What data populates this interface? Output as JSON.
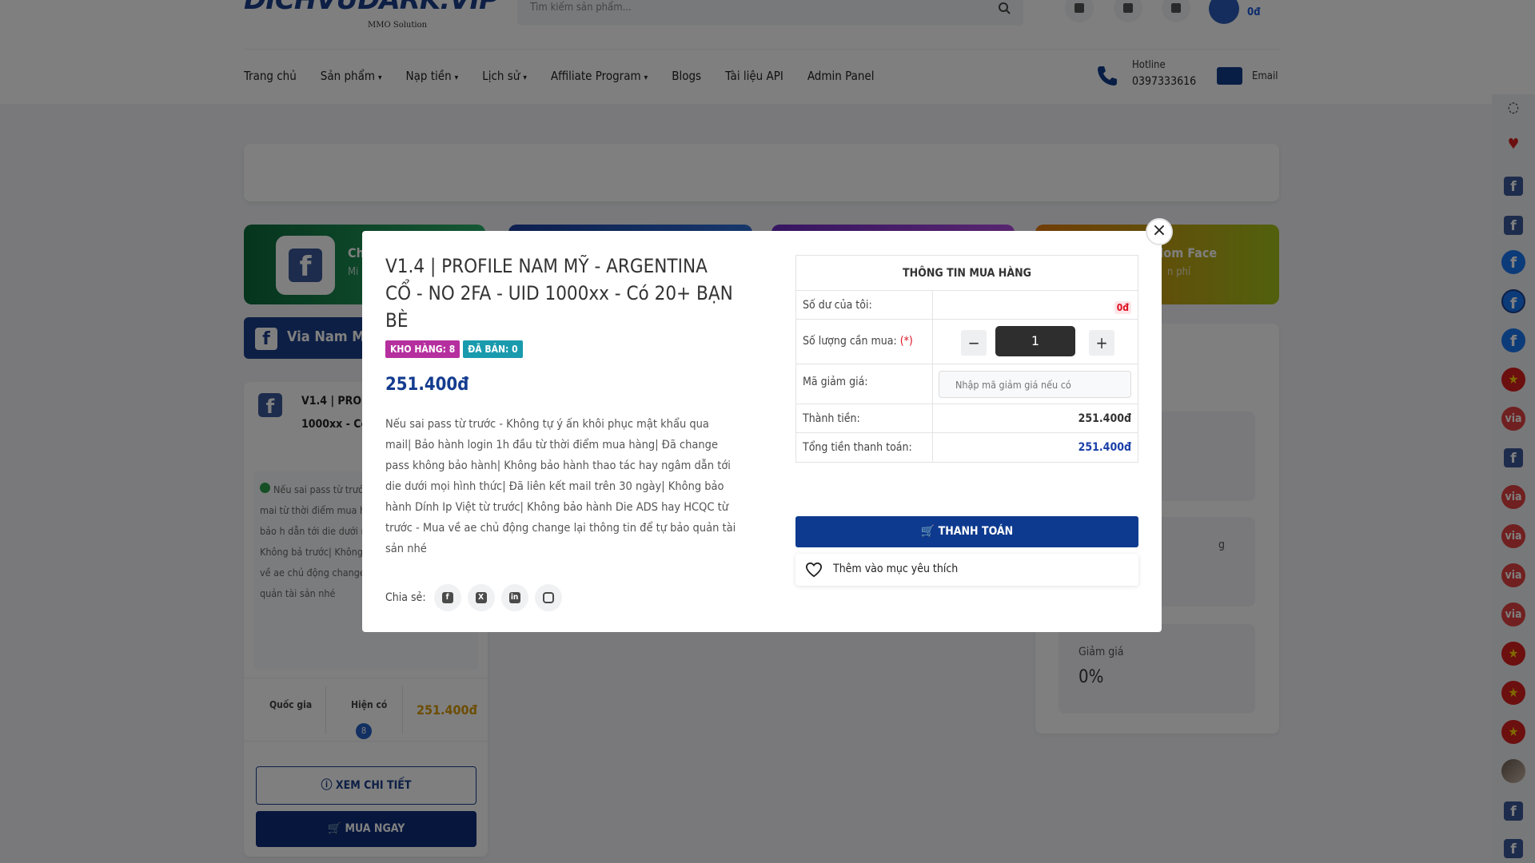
{
  "header": {
    "logo_text": "DICHVUDARK.VIP",
    "logo_sub": "MMO Solution",
    "search_placeholder": "Tìm kiếm sản phẩm...",
    "balance": "0đ"
  },
  "nav": {
    "items": [
      {
        "label": "Trang chủ",
        "caret": false
      },
      {
        "label": "Sản phẩm",
        "caret": true
      },
      {
        "label": "Nạp tiền",
        "caret": true
      },
      {
        "label": "Lịch sử",
        "caret": true
      },
      {
        "label": "Affiliate Program",
        "caret": true
      },
      {
        "label": "Blogs",
        "caret": false
      },
      {
        "label": "Tài liệu API",
        "caret": false
      },
      {
        "label": "Admin Panel",
        "caret": false
      }
    ],
    "hotline_label": "Hotline",
    "hotline_number": "0397333616",
    "email_label": "Email"
  },
  "categories": [
    {
      "title": "Ch",
      "sub": "Mi"
    },
    {
      "title": "dom Face",
      "sub": "n phí"
    }
  ],
  "section_tab": "Via Nam Mỹ",
  "product_card": {
    "title": "V1.4 | PROF ARGENTINA 1000xx - Có",
    "desc": "Nếu sai pass từ trước phục mật khẩu qua mai từ thời điểm mua hàng bảo hành| Không bảo h dẫn tới die dưới mọi hìn trên 30 ngày| Không bả trước| Không bảo hành trước - Mua về ae chủ động change lại thông tin để tự bảo quản tài sản nhé",
    "stat_country": "Quốc gia",
    "stat_stock": "Hiện có",
    "stock": "8",
    "price": "251.400đ",
    "detail_button": "XEM CHI TIẾT",
    "buy_button": "MUA NGAY"
  },
  "right_panel": {
    "label_1": "g",
    "discount_label": "Giảm giá",
    "discount_value": "0%"
  },
  "modal": {
    "title": "V1.4 | PROFILE NAM MỸ - ARGENTINA CỔ - NO 2FA - UID 1000xx - Có 20+ BẠN BÈ",
    "badge_stock": "KHO HÀNG: 8",
    "badge_sold": "ĐÃ BÁN: 0",
    "price": "251.400đ",
    "description": "Nếu sai pass từ trước - Không tự ý ấn khôi phục mật khẩu qua mail| Bảo hành login 1h đầu từ thời điểm mua hàng| Đã change pass không bảo hành| Không bảo hành thao tác hay ngâm dẫn tới die dưới mọi hình thức| Đã liên kết mail trên 30 ngày| Không bảo hành Dính Ip Việt từ trước| Không bảo hành Die ADS hay HCQC từ trước - Mua về ae chủ động change lại thông tin để tự bảo quản tài sản nhé",
    "share_label": "Chia sẻ:",
    "share_icons": [
      "facebook-icon",
      "x-twitter-icon",
      "linkedin-icon",
      "instagram-icon"
    ],
    "close_symbol": "×"
  },
  "purchase": {
    "heading": "THÔNG TIN MUA HÀNG",
    "balance_label": "Số dư của tôi:",
    "balance_value": "0đ",
    "qty_label": "Số lượng cần mua:",
    "qty_required": "(*)",
    "qty_value": "1",
    "qty_minus": "−",
    "qty_plus": "+",
    "coupon_label": "Mã giảm giá:",
    "coupon_placeholder": "Nhập mã giảm giá nếu có",
    "subtotal_label": "Thành tiền:",
    "subtotal_value": "251.400đ",
    "total_label": "Tổng tiền thanh toán:",
    "total_value": "251.400đ",
    "pay_button": "THANH TOÁN",
    "wishlist_label": "Thêm vào mục yêu thích"
  },
  "colors": {
    "primary": "#0d3a8f",
    "price_blue": "#133b8f",
    "badge_stock": "#b52f9e",
    "badge_sold": "#199aad",
    "gold_price": "#d89a06",
    "danger": "#dd1122"
  },
  "rail_icons": [
    "eye-slash-icon",
    "heart-icon",
    "facebook-icon",
    "facebook-icon",
    "facebook-icon",
    "facebook-icon",
    "facebook-icon",
    "vietnam-flag-icon",
    "via-icon",
    "facebook-icon",
    "via-icon",
    "via-icon",
    "via-icon",
    "via-icon",
    "vietnam-flag-icon",
    "vietnam-flag-icon",
    "vietnam-flag-icon",
    "profile-photo-icon",
    "facebook-icon",
    "facebook-icon"
  ]
}
